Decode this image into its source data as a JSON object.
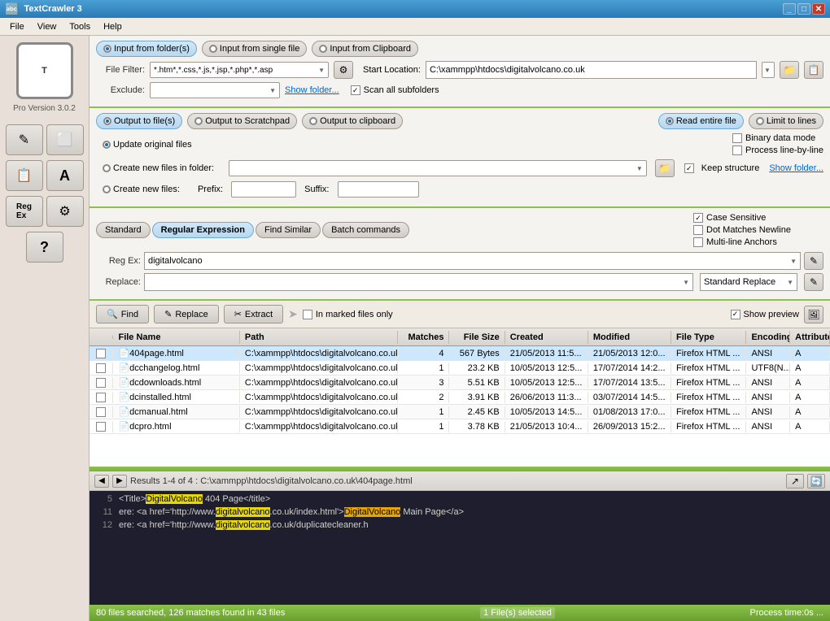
{
  "window": {
    "title": "TextCrawler 3"
  },
  "menu": {
    "items": [
      "File",
      "View",
      "Tools",
      "Help"
    ]
  },
  "app": {
    "version": "Pro Version 3.0.2",
    "logo": "T"
  },
  "input_section": {
    "options": [
      "Input from folder(s)",
      "Input from single file",
      "Input from Clipboard"
    ],
    "active_option": 0,
    "file_filter_label": "File Filter:",
    "file_filter_value": "*.htm*,*.css,*.js,*.jsp,*.php*,*.asp",
    "exclude_label": "Exclude:",
    "exclude_value": "",
    "show_folder": "Show folder...",
    "scan_subfolders_label": "Scan all subfolders",
    "scan_subfolders": true,
    "start_location_label": "Start Location:",
    "start_location": "C:\\xammpp\\htdocs\\digitalvolcano.co.uk"
  },
  "output_section": {
    "options": [
      "Output to file(s)",
      "Output to Scratchpad",
      "Output to clipboard"
    ],
    "active_option": 0,
    "suboptions": [
      "Update original files",
      "Create new files in folder:",
      "Create new files:"
    ],
    "active_suboption": 0,
    "keep_structure_label": "Keep structure",
    "show_folder": "Show folder...",
    "prefix_label": "Prefix:",
    "suffix_label": "Suffix:",
    "read_options": [
      "Read entire file",
      "Limit to lines"
    ],
    "active_read": 0,
    "binary_data_label": "Binary data mode",
    "process_line_label": "Process line-by-line"
  },
  "regex_section": {
    "tabs": [
      "Standard",
      "Regular Expression",
      "Find Similar",
      "Batch commands"
    ],
    "active_tab": 1,
    "regex_label": "Reg Ex:",
    "regex_value": "digitalvolcano",
    "replace_label": "Replace:",
    "replace_value": "",
    "replace_mode": "Standard Replace",
    "checkboxes": {
      "case_sensitive": "Case Sensitive",
      "dot_newline": "Dot Matches Newline",
      "multiline": "Multi-line Anchors"
    }
  },
  "action_bar": {
    "find_label": "Find",
    "replace_label": "Replace",
    "extract_label": "Extract",
    "marked_only_label": "In marked files only",
    "show_preview_label": "Show preview"
  },
  "table": {
    "columns": [
      "",
      "File Name",
      "Path",
      "Matches",
      "File Size",
      "Created",
      "Modified",
      "File Type",
      "Encoding",
      "Attributes"
    ],
    "rows": [
      {
        "checked": false,
        "filename": "404page.html",
        "path": "C:\\xammpp\\htdocs\\digitalvolcano.co.uk",
        "matches": "4",
        "size": "567 Bytes",
        "created": "21/05/2013 11:5...",
        "modified": "21/05/2013 12:0...",
        "filetype": "Firefox HTML ...",
        "encoding": "ANSI",
        "attrs": "A",
        "selected": true
      },
      {
        "checked": false,
        "filename": "dcchangelog.html",
        "path": "C:\\xammpp\\htdocs\\digitalvolcano.co.uk",
        "matches": "1",
        "size": "23.2 KB",
        "created": "10/05/2013 12:5...",
        "modified": "17/07/2014 14:2...",
        "filetype": "Firefox HTML ...",
        "encoding": "UTF8(N...",
        "attrs": "A",
        "selected": false
      },
      {
        "checked": false,
        "filename": "dcdownloads.html",
        "path": "C:\\xammpp\\htdocs\\digitalvolcano.co.uk",
        "matches": "3",
        "size": "5.51 KB",
        "created": "10/05/2013 12:5...",
        "modified": "17/07/2014 13:5...",
        "filetype": "Firefox HTML ...",
        "encoding": "ANSI",
        "attrs": "A",
        "selected": false
      },
      {
        "checked": false,
        "filename": "dcinstalled.html",
        "path": "C:\\xammpp\\htdocs\\digitalvolcano.co.uk",
        "matches": "2",
        "size": "3.91 KB",
        "created": "26/06/2013 11:3...",
        "modified": "03/07/2014 14:5...",
        "filetype": "Firefox HTML ...",
        "encoding": "ANSI",
        "attrs": "A",
        "selected": false
      },
      {
        "checked": false,
        "filename": "dcmanual.html",
        "path": "C:\\xammpp\\htdocs\\digitalvolcano.co.uk",
        "matches": "1",
        "size": "2.45 KB",
        "created": "10/05/2013 14:5...",
        "modified": "01/08/2013 17:0...",
        "filetype": "Firefox HTML ...",
        "encoding": "ANSI",
        "attrs": "A",
        "selected": false
      },
      {
        "checked": false,
        "filename": "dcpro.html",
        "path": "C:\\xammpp\\htdocs\\digitalvolcano.co.uk",
        "matches": "1",
        "size": "3.78 KB",
        "created": "21/05/2013 10:4...",
        "modified": "26/09/2013 15:2...",
        "filetype": "Firefox HTML ...",
        "encoding": "ANSI",
        "attrs": "A",
        "selected": false
      }
    ]
  },
  "preview": {
    "nav_label": "Results 1-4 of 4 : C:\\xammpp\\htdocs\\digitalvolcano.co.uk\\404page.html",
    "lines": [
      {
        "num": "5",
        "prefix": "",
        "text": "<Title>",
        "highlight1": "DigitalVolcano",
        "middle": " 404 Page</title>",
        "highlight2": ""
      },
      {
        "num": "11",
        "prefix": "ere: <a href='http://www.",
        "highlight1": "digitalvolcano",
        "middle": ".co.uk/index.html'>",
        "highlight2": "DigitalVolcano",
        "suffix": " Main Page</a>"
      },
      {
        "num": "12",
        "prefix": "ere: <a href='http://www.",
        "highlight1": "digitalvolcano",
        "middle": ".co.uk/duplicatecleaner.h",
        "highlight2": "",
        "suffix": ""
      }
    ]
  },
  "status": {
    "main": "80 files searched, 126 matches found in 43 files",
    "selected": "1 File(s) selected",
    "process_time": "Process time:0s  ..."
  },
  "colors": {
    "accent_green": "#8bc34a",
    "title_blue": "#2a7ab5",
    "selected_bg": "#cde8fc"
  }
}
